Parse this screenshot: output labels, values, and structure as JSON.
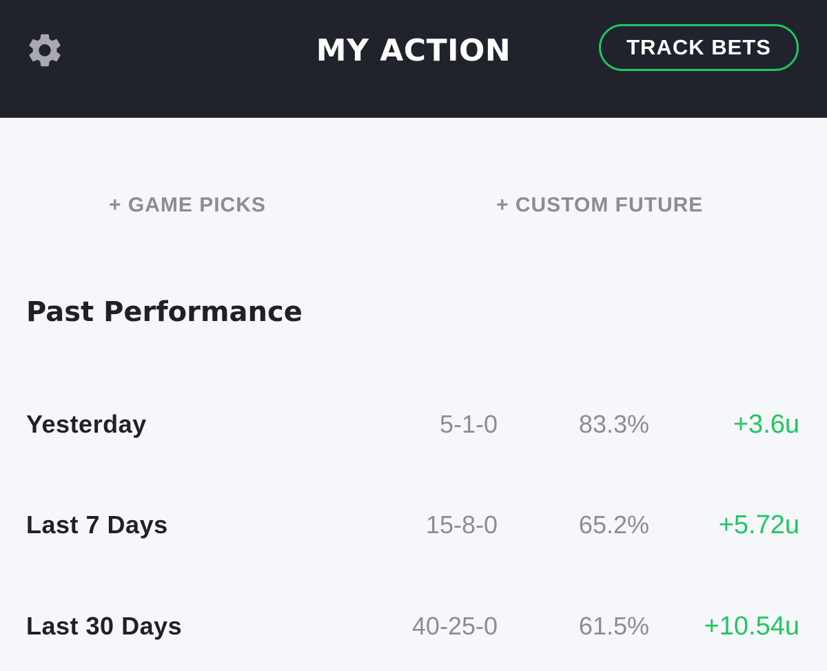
{
  "header": {
    "title": "MY ACTION",
    "settings_icon": "gear-icon",
    "track_button_label": "TRACK BETS"
  },
  "actions": {
    "game_picks_label": "+ GAME PICKS",
    "custom_future_label": "+ CUSTOM FUTURE"
  },
  "performance": {
    "title": "Past Performance",
    "rows": [
      {
        "label": "Yesterday",
        "record": "5-1-0",
        "percent": "83.3%",
        "units": "+3.6u"
      },
      {
        "label": "Last 7 Days",
        "record": "15-8-0",
        "percent": "65.2%",
        "units": "+5.72u"
      },
      {
        "label": "Last 30 Days",
        "record": "40-25-0",
        "percent": "61.5%",
        "units": "+10.54u"
      }
    ]
  },
  "colors": {
    "header_bg": "#20232b",
    "page_bg": "#f6f7fb",
    "accent_green": "#1ec760",
    "muted_text": "#8a8d92",
    "primary_text": "#1f2126"
  }
}
